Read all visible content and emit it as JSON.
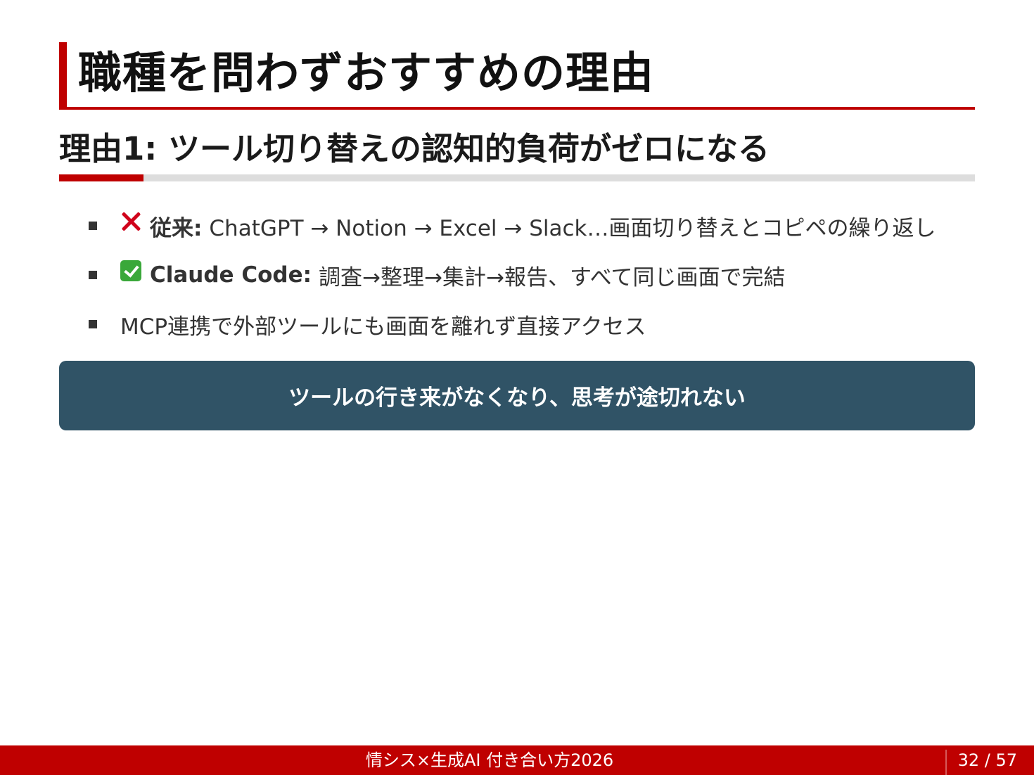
{
  "slide": {
    "title": "職種を問わずおすすめの理由",
    "subtitle": "理由1: ツール切り替えの認知的負荷がゼロになる",
    "bullets": [
      {
        "icon": "cross-mark-icon",
        "label": "従来:",
        "text": "ChatGPT → Notion → Excel → Slack…画面切り替えとコピペの繰り返し"
      },
      {
        "icon": "check-mark-button-icon",
        "label": "Claude Code:",
        "text": "調査→整理→集計→報告、すべて同じ画面で完結"
      },
      {
        "text": "MCP連携で外部ツールにも画面を離れず直接アクセス"
      }
    ],
    "callout": "ツールの行き来がなくなり、思考が途切れない"
  },
  "footer": {
    "text": "情シス×生成AI 付き合い方2026",
    "page": "32 / 57"
  },
  "colors": {
    "accent": "#bf0000",
    "callout_bg": "#305366",
    "cross": "#d0021b",
    "check": "#3aa83a"
  }
}
